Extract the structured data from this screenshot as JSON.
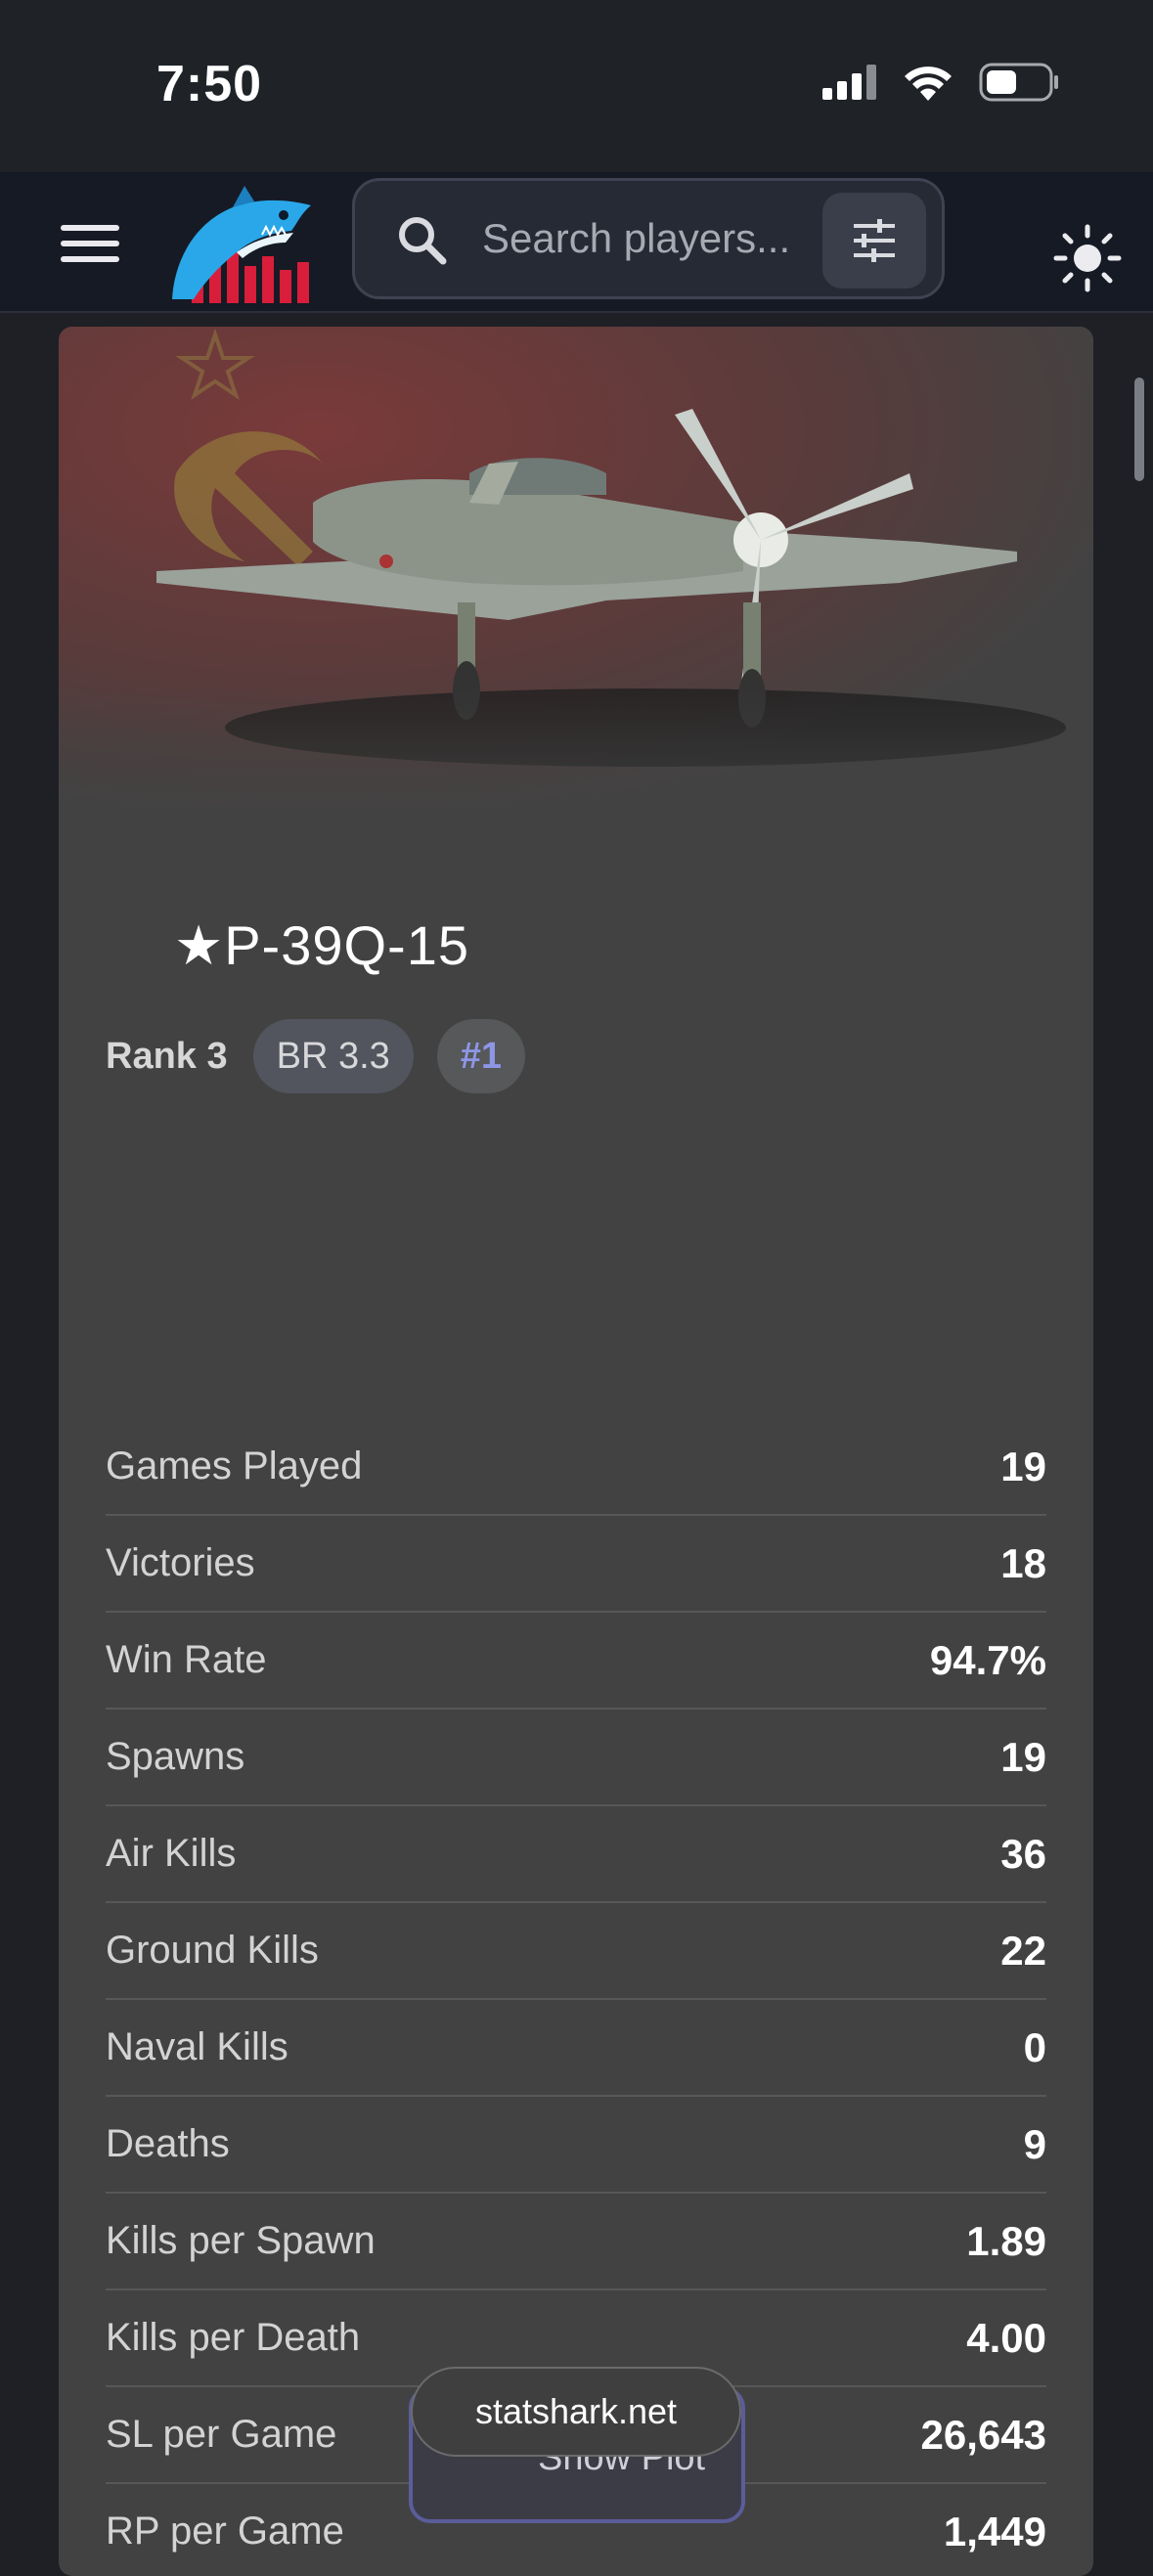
{
  "status_bar": {
    "time": "7:50"
  },
  "search": {
    "placeholder": "Search players..."
  },
  "vehicle": {
    "name": "★P-39Q-15",
    "rank": "Rank 3",
    "br": "BR 3.3",
    "position": "#1"
  },
  "stats": [
    {
      "label": "Games Played",
      "value": "19"
    },
    {
      "label": "Victories",
      "value": "18"
    },
    {
      "label": "Win Rate",
      "value": "94.7%"
    },
    {
      "label": "Spawns",
      "value": "19"
    },
    {
      "label": "Air Kills",
      "value": "36"
    },
    {
      "label": "Ground Kills",
      "value": "22"
    },
    {
      "label": "Naval Kills",
      "value": "0"
    },
    {
      "label": "Deaths",
      "value": "9"
    },
    {
      "label": "Kills per Spawn",
      "value": "1.89"
    },
    {
      "label": "Kills per Death",
      "value": "4.00"
    },
    {
      "label": "SL per Game",
      "value": "26,643"
    },
    {
      "label": "RP per Game",
      "value": "1,449"
    }
  ],
  "plot_button": {
    "label": "Show Plot"
  },
  "site": {
    "url": "statshark.net"
  },
  "icons": {
    "menu": "hamburger-icon",
    "search": "search-icon",
    "filter": "sliders-icon",
    "theme": "sun-icon"
  },
  "colors": {
    "accent": "#8e96e6",
    "logo_bars": "#d81e3b",
    "logo_shark": "#2aa7e8"
  }
}
